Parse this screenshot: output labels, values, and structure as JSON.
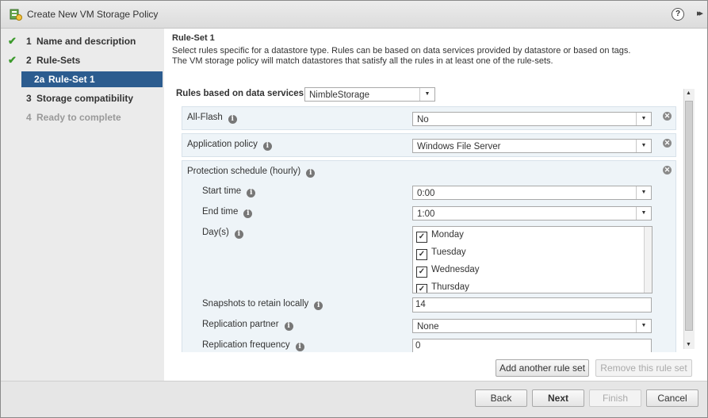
{
  "window": {
    "title": "Create New VM Storage Policy",
    "help_symbol": "?",
    "expand_symbol": "▸▸"
  },
  "steps": [
    {
      "num": "1",
      "label": "Name and description",
      "status": "done"
    },
    {
      "num": "2",
      "label": "Rule-Sets",
      "status": "done"
    },
    {
      "num": "2a",
      "label": "Rule-Set 1",
      "status": "current"
    },
    {
      "num": "3",
      "label": "Storage compatibility",
      "status": "pending"
    },
    {
      "num": "4",
      "label": "Ready to complete",
      "status": "disabled"
    }
  ],
  "main": {
    "heading": "Rule-Set 1",
    "description_line1": "Select rules specific for a datastore type. Rules can be based on data services provided by datastore or based on tags.",
    "description_line2": "The VM storage policy will match datastores that satisfy all the rules in at least one of the rule-sets."
  },
  "rules": {
    "services_label": "Rules based on data services",
    "services_value": "NimbleStorage",
    "all_flash_label": "All-Flash",
    "all_flash_value": "No",
    "app_policy_label": "Application policy",
    "app_policy_value": "Windows File Server",
    "protection_label": "Protection schedule (hourly)",
    "start_time_label": "Start time",
    "start_time_value": "0:00",
    "end_time_label": "End time",
    "end_time_value": "1:00",
    "days_label": "Day(s)",
    "days": [
      "Monday",
      "Tuesday",
      "Wednesday",
      "Thursday"
    ],
    "snapshots_label": "Snapshots to retain locally",
    "snapshots_value": "14",
    "replication_partner_label": "Replication partner",
    "replication_partner_value": "None",
    "replication_frequency_label": "Replication frequency",
    "replication_frequency_value": "0"
  },
  "actions": {
    "add_rule_set": "Add another rule set",
    "remove_rule_set": "Remove this rule set"
  },
  "footer": {
    "back": "Back",
    "next": "Next",
    "finish": "Finish",
    "cancel": "Cancel"
  },
  "colors": {
    "check": "#3c9a2c",
    "selected_step": "#2c5c8f",
    "rule_bg": "#eef4f8"
  },
  "icons": {
    "info": "info-icon",
    "remove": "remove-icon",
    "check": "check-icon"
  }
}
